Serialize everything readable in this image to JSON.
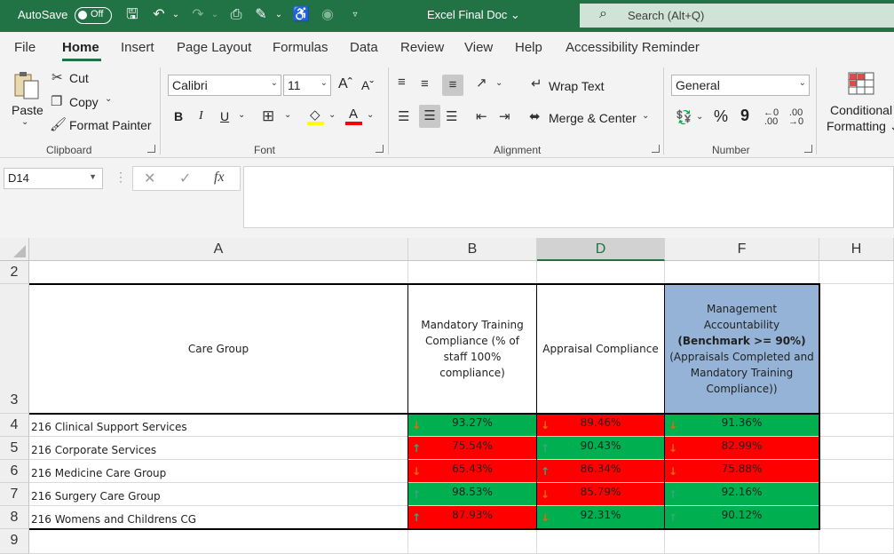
{
  "titlebar": {
    "autosave_label": "AutoSave",
    "autosave_state": "Off",
    "doc_title": "Excel Final Doc",
    "search_placeholder": "Search (Alt+Q)",
    "bg_color": "#217346"
  },
  "tabs": [
    "File",
    "Home",
    "Insert",
    "Page Layout",
    "Formulas",
    "Data",
    "Review",
    "View",
    "Help",
    "Accessibility Reminder"
  ],
  "active_tab": "Home",
  "ribbon": {
    "clipboard": {
      "paste": "Paste",
      "cut": "Cut",
      "copy": "Copy",
      "format_painter": "Format Painter",
      "label": "Clipboard"
    },
    "font": {
      "name": "Calibri",
      "size": "11",
      "bold": "B",
      "italic": "I",
      "underline": "U",
      "label": "Font"
    },
    "alignment": {
      "wrap_text": "Wrap Text",
      "merge_center": "Merge & Center",
      "label": "Alignment"
    },
    "number": {
      "format": "General",
      "percent": "%",
      "comma": "9",
      "label": "Number"
    },
    "styles": {
      "conditional_1": "Conditional",
      "conditional_2": "Formatting"
    }
  },
  "formula_bar": {
    "name_box": "D14",
    "formula": ""
  },
  "grid": {
    "columns": [
      "A",
      "B",
      "D",
      "F",
      "H"
    ],
    "selected_column": "D",
    "rows": [
      "2",
      "3",
      "4",
      "5",
      "6",
      "7",
      "8",
      "9"
    ],
    "headers": {
      "care_group": "Care Group",
      "mandatory_training": "Mandatory Training Compliance (% of staff 100% compliance)",
      "appraisal": "Appraisal Compliance",
      "mgmt_line1": "Management Accountability",
      "mgmt_bold": "(Benchmark >= 90%)",
      "mgmt_line3": "(Appraisals Completed and Mandatory Training Compliance))"
    },
    "data": [
      {
        "name": "216 Clinical Support Services",
        "b": "93.27%",
        "b_dir": "down",
        "b_color": "green",
        "d": "89.46%",
        "d_dir": "down",
        "d_color": "red",
        "f": "91.36%",
        "f_dir": "down",
        "f_color": "green"
      },
      {
        "name": "216 Corporate Services",
        "b": "75.54%",
        "b_dir": "up",
        "b_color": "red",
        "d": "90.43%",
        "d_dir": "up",
        "d_color": "green",
        "f": "82.99%",
        "f_dir": "down",
        "f_color": "red"
      },
      {
        "name": "216 Medicine Care Group",
        "b": "65.43%",
        "b_dir": "down",
        "b_color": "red",
        "d": "86.34%",
        "d_dir": "up",
        "d_color": "red",
        "f": "75.88%",
        "f_dir": "down",
        "f_color": "red"
      },
      {
        "name": "216 Surgery Care Group",
        "b": "98.53%",
        "b_dir": "up",
        "b_color": "green",
        "d": "85.79%",
        "d_dir": "down",
        "d_color": "red",
        "f": "92.16%",
        "f_dir": "up",
        "f_color": "green"
      },
      {
        "name": "216 Womens and Childrens CG",
        "b": "87.93%",
        "b_dir": "up",
        "b_color": "red",
        "d": "92.31%",
        "d_dir": "down",
        "d_color": "green",
        "f": "90.12%",
        "f_dir": "up",
        "f_color": "green"
      }
    ],
    "colors": {
      "red": "#ff0000",
      "green": "#00b050",
      "header_blue": "#95b3d7",
      "arrow_down": "#e26b0a",
      "arrow_up": "#3aa57a"
    }
  }
}
